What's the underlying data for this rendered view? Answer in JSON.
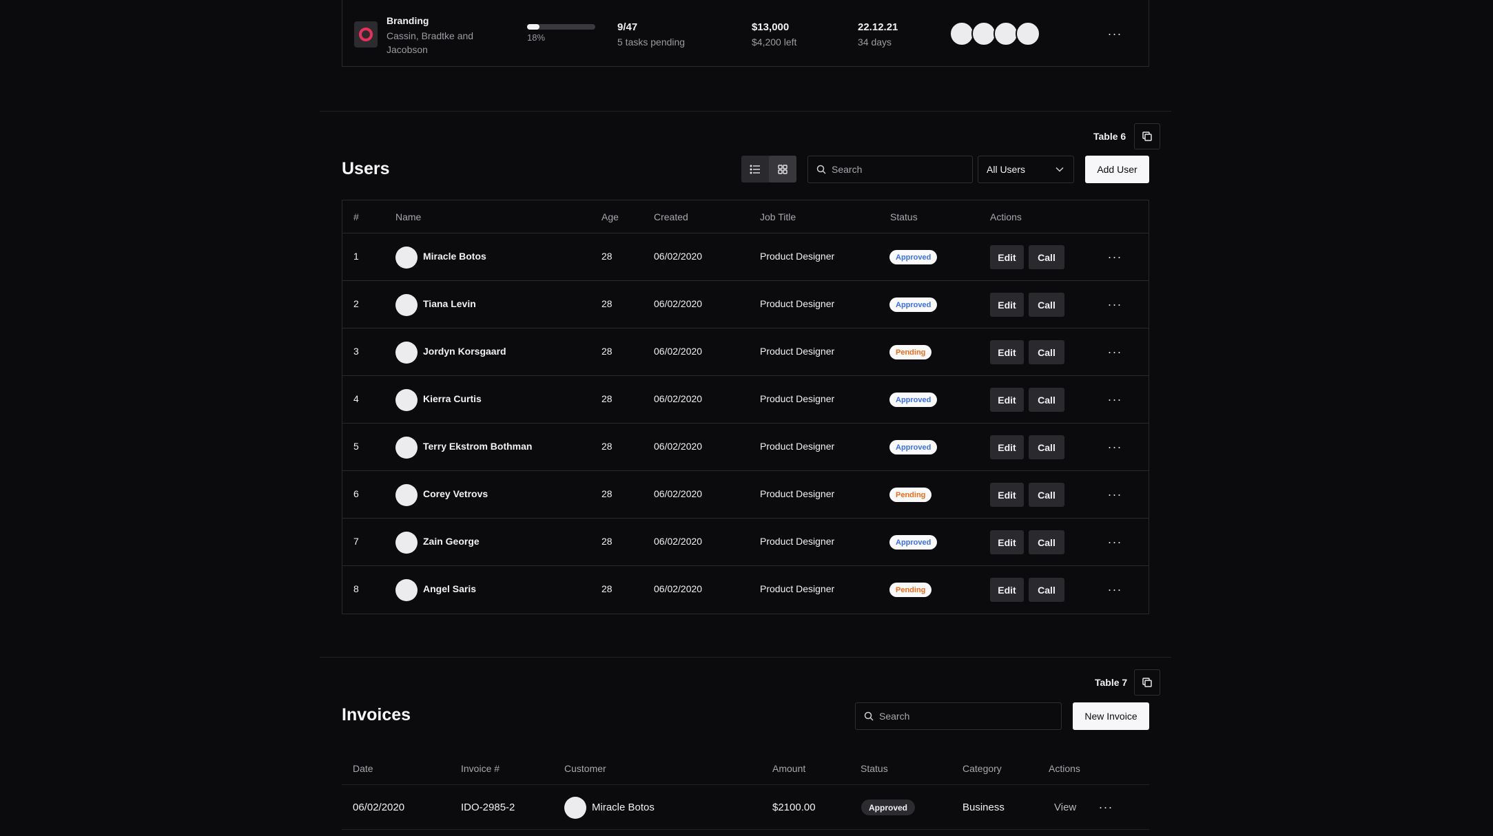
{
  "project": {
    "name": "Branding",
    "client": "Cassin, Bradtke and Jacobson",
    "progress_percent": 18,
    "progress_label": "18%",
    "tasks": "9/47",
    "tasks_pending": "5 tasks pending",
    "budget": "$13,000",
    "budget_left": "$4,200 left",
    "due_date": "22.12.21",
    "due_days": "34 days",
    "logo_color": "#e8315a"
  },
  "users_section": {
    "table_tag": "Table 6",
    "title": "Users",
    "search_placeholder": "Search",
    "filter_value": "All Users",
    "add_button": "Add User",
    "columns": {
      "index": "#",
      "name": "Name",
      "age": "Age",
      "created": "Created",
      "job_title": "Job Title",
      "status": "Status",
      "actions": "Actions"
    },
    "edit_label": "Edit",
    "call_label": "Call",
    "rows": [
      {
        "index": "1",
        "name": "Miracle Botos",
        "age": "28",
        "created": "06/02/2020",
        "job": "Product Designer",
        "status": "Approved",
        "status_key": "approved"
      },
      {
        "index": "2",
        "name": "Tiana Levin",
        "age": "28",
        "created": "06/02/2020",
        "job": "Product Designer",
        "status": "Approved",
        "status_key": "approved"
      },
      {
        "index": "3",
        "name": "Jordyn Korsgaard",
        "age": "28",
        "created": "06/02/2020",
        "job": "Product Designer",
        "status": "Pending",
        "status_key": "pending"
      },
      {
        "index": "4",
        "name": "Kierra Curtis",
        "age": "28",
        "created": "06/02/2020",
        "job": "Product Designer",
        "status": "Approved",
        "status_key": "approved"
      },
      {
        "index": "5",
        "name": "Terry Ekstrom Bothman",
        "age": "28",
        "created": "06/02/2020",
        "job": "Product Designer",
        "status": "Approved",
        "status_key": "approved"
      },
      {
        "index": "6",
        "name": "Corey Vetrovs",
        "age": "28",
        "created": "06/02/2020",
        "job": "Product Designer",
        "status": "Pending",
        "status_key": "pending"
      },
      {
        "index": "7",
        "name": "Zain George",
        "age": "28",
        "created": "06/02/2020",
        "job": "Product Designer",
        "status": "Approved",
        "status_key": "approved"
      },
      {
        "index": "8",
        "name": "Angel Saris",
        "age": "28",
        "created": "06/02/2020",
        "job": "Product Designer",
        "status": "Pending",
        "status_key": "pending"
      }
    ]
  },
  "invoices_section": {
    "table_tag": "Table 7",
    "title": "Invoices",
    "search_placeholder": "Search",
    "new_button": "New Invoice",
    "columns": {
      "date": "Date",
      "invoice": "Invoice #",
      "customer": "Customer",
      "amount": "Amount",
      "status": "Status",
      "category": "Category",
      "actions": "Actions"
    },
    "rows": [
      {
        "date": "06/02/2020",
        "invoice": "IDO-2985-2",
        "customer": "Miracle Botos",
        "amount": "$2100.00",
        "status": "Approved",
        "category": "Business",
        "view_label": "View"
      }
    ]
  },
  "icons": {
    "list_view": "list-icon",
    "grid_view": "grid-icon",
    "search": "search-icon",
    "chevron": "chevron-down-icon",
    "copy": "copy-icon",
    "more": "more-horizontal-icon"
  },
  "colors": {
    "background": "#0b0b0d",
    "approved": "#3a6ff2",
    "pending": "#ef6a1a"
  }
}
